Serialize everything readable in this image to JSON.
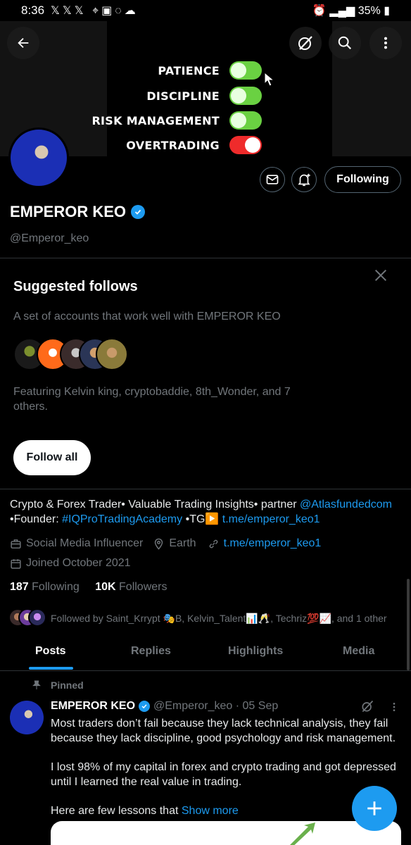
{
  "status_bar": {
    "time": "8:36",
    "left_icons": [
      "x-icon",
      "x-icon",
      "x-icon",
      "location-icon",
      "gallery-icon",
      "whatsapp-icon",
      "cloud-icon"
    ],
    "battery": "35%"
  },
  "banner": {
    "toggles": [
      {
        "label": "PATIENCE",
        "state": "on"
      },
      {
        "label": "DISCIPLINE",
        "state": "on"
      },
      {
        "label": "RISK MANAGEMENT",
        "state": "on"
      },
      {
        "label": "OVERTRADING",
        "state": "off"
      }
    ],
    "colors": {
      "on": "#6ad142",
      "off": "#ef2b2b"
    }
  },
  "profile": {
    "name": "EMPEROR KEO",
    "handle": "@Emperor_keo",
    "following_button": "Following",
    "bio_prefix": "Crypto & Forex Trader• Valuable Trading Insights• partner ",
    "bio_mention": "@Atlasfundedcom",
    "bio_founder": "•Founder: ",
    "bio_hashtag": "#IQProTradingAcademy",
    "bio_tg": " •TG▶️ ",
    "bio_link": "t.me/emperor_keo1",
    "category": "Social Media Influencer",
    "location": "Earth",
    "website": "t.me/emperor_keo1",
    "joined": "Joined October 2021",
    "following_count": "187",
    "following_label": "Following",
    "followers_count": "10K",
    "followers_label": "Followers",
    "followed_by": "Followed by Saint_Krrypt 🎭B, Kelvin_Talent📊🥂, Techriz💯📈, and 1 other"
  },
  "suggested": {
    "title": "Suggested follows",
    "subtitle": "A set of accounts that work well with EMPEROR KEO",
    "featuring": "Featuring Kelvin king, cryptobaddie, 8th_Wonder, and 7 others.",
    "follow_all": "Follow all"
  },
  "tabs": [
    "Posts",
    "Replies",
    "Highlights",
    "Media"
  ],
  "active_tab": "Posts",
  "post": {
    "pinned_label": "Pinned",
    "author": "EMPEROR KEO",
    "handle_date": "@Emperor_keo · 05 Sep",
    "para1": "Most traders don’t fail because they lack technical analysis, they fail because they lack discipline, good psychology and risk management.",
    "para2": "I lost 98% of my capital in forex and crypto trading and got depressed until I learned the real value in trading.",
    "para3": "Here are few lessons that ",
    "show_more": "Show more"
  },
  "accent_color": "#1d9bf0"
}
